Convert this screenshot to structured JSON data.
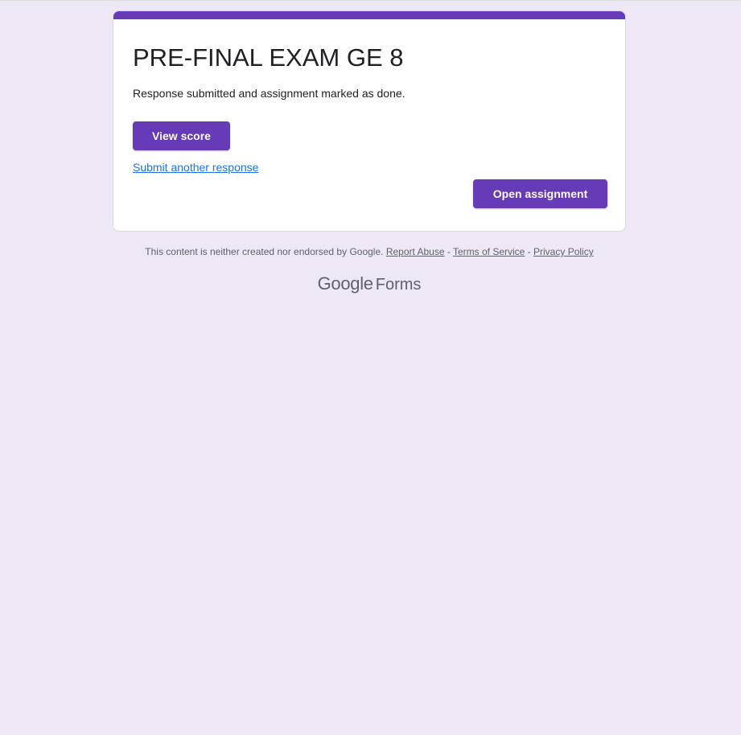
{
  "form": {
    "title": "PRE-FINAL EXAM GE 8",
    "confirmation_message": "Response submitted and assignment marked as done.",
    "view_score_label": "View score",
    "submit_another_label": "Submit another response",
    "open_assignment_label": "Open assignment"
  },
  "footer": {
    "disclaimer": "This content is neither created nor endorsed by Google.",
    "report_abuse": "Report Abuse",
    "separator": " - ",
    "terms": "Terms of Service",
    "privacy": "Privacy Policy"
  },
  "brand": {
    "google": "Google",
    "forms": "Forms"
  },
  "colors": {
    "background": "#ede7f6",
    "accent": "#673ab7",
    "link": "#1a73e8"
  }
}
